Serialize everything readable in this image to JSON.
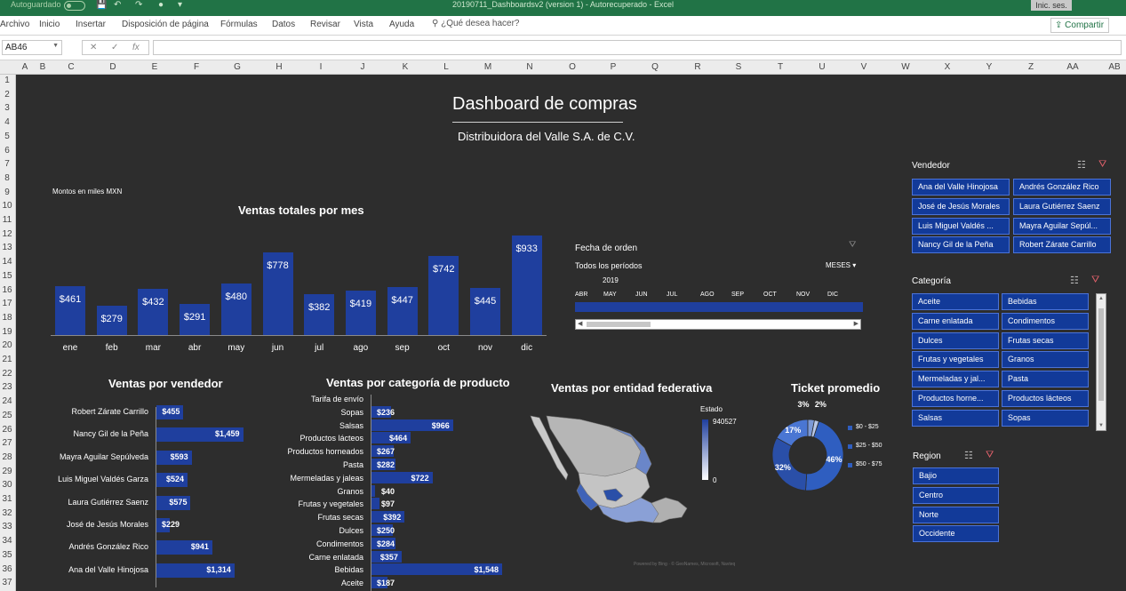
{
  "window": {
    "autosave_label": "Autoguardado",
    "document_title": "20190711_Dashboardsv2 (version 1) - Autorecuperado - Excel",
    "signin_label": "Inic. ses."
  },
  "ribbon": {
    "tabs": [
      "Archivo",
      "Inicio",
      "Insertar",
      "Disposición de página",
      "Fórmulas",
      "Datos",
      "Revisar",
      "Vista",
      "Ayuda"
    ],
    "tell_me": "¿Qué desea hacer?",
    "share_label": "Compartir"
  },
  "formula_bar": {
    "name_box": "AB46",
    "cancel_glyph": "✕",
    "enter_glyph": "✓",
    "fx_glyph": "fx",
    "formula": ""
  },
  "columns": [
    "A",
    "B",
    "C",
    "D",
    "E",
    "F",
    "G",
    "H",
    "I",
    "J",
    "K",
    "L",
    "M",
    "N",
    "O",
    "P",
    "Q",
    "R",
    "S",
    "T",
    "U",
    "V",
    "W",
    "X",
    "Y",
    "Z",
    "AA",
    "AB"
  ],
  "rows": [
    "1",
    "2",
    "3",
    "4",
    "5",
    "6",
    "7",
    "8",
    "9",
    "10",
    "11",
    "12",
    "13",
    "14",
    "15",
    "16",
    "17",
    "18",
    "19",
    "20",
    "21",
    "22",
    "23",
    "24",
    "25",
    "26",
    "27",
    "28",
    "29",
    "30",
    "31",
    "32",
    "33",
    "34",
    "35",
    "36",
    "37"
  ],
  "dashboard": {
    "title": "Dashboard de compras",
    "subtitle": "Distribuidora del Valle S.A. de C.V.",
    "amount_note": "Montos en miles MXN"
  },
  "chart_data": [
    {
      "type": "bar",
      "title": "Ventas totales por mes",
      "categories": [
        "ene",
        "feb",
        "mar",
        "abr",
        "may",
        "jun",
        "jul",
        "ago",
        "sep",
        "oct",
        "nov",
        "dic"
      ],
      "values": [
        461,
        279,
        432,
        291,
        480,
        778,
        382,
        419,
        447,
        742,
        445,
        933
      ],
      "value_labels": [
        "$461",
        "$279",
        "$432",
        "$291",
        "$480",
        "$778",
        "$382",
        "$419",
        "$447",
        "$742",
        "$445",
        "$933"
      ],
      "ylim": [
        0,
        950
      ],
      "grid": false,
      "color": "#1f3f9e"
    },
    {
      "type": "bar",
      "orientation": "horizontal",
      "title": "Ventas por vendedor",
      "categories": [
        "Robert Zárate Carrillo",
        "Nancy Gil de la Peña",
        "Mayra Aguilar Sepúlveda",
        "Luis Miguel Valdés Garza",
        "Laura Gutiérrez Saenz",
        "José de Jesús Morales",
        "Andrés González Rico",
        "Ana del Valle Hinojosa"
      ],
      "values": [
        455,
        1459,
        593,
        524,
        575,
        229,
        941,
        1314
      ],
      "value_labels": [
        "$455",
        "$1,459",
        "$593",
        "$524",
        "$575",
        "$229",
        "$941",
        "$1,314"
      ],
      "xlim": [
        0,
        1600
      ],
      "color": "#1f3f9e"
    },
    {
      "type": "bar",
      "orientation": "horizontal",
      "title": "Ventas por categoría de producto",
      "categories": [
        "Tarifa de envío",
        "Sopas",
        "Salsas",
        "Productos lácteos",
        "Productos horneados",
        "Pasta",
        "Mermeladas y jaleas",
        "Granos",
        "Frutas y vegetales",
        "Frutas secas",
        "Dulces",
        "Condimentos",
        "Carne enlatada",
        "Bebidas",
        "Aceite"
      ],
      "values": [
        0,
        236,
        966,
        464,
        267,
        282,
        722,
        40,
        97,
        392,
        250,
        284,
        357,
        1548,
        187
      ],
      "value_labels": [
        "",
        "$236",
        "$966",
        "$464",
        "$267",
        "$282",
        "$722",
        "$40",
        "$97",
        "$392",
        "$250",
        "$284",
        "$357",
        "$1,548",
        "$187"
      ],
      "xlim": [
        0,
        1600
      ],
      "color": "#1f3f9e"
    },
    {
      "type": "pie",
      "title": "Ticket promedio",
      "donut": true,
      "labels": [
        "$0 - $25",
        "$25 - $50",
        "$50 - $75"
      ],
      "slices": [
        {
          "label": "46%",
          "value": 46,
          "color": "#2f5ec0"
        },
        {
          "label": "32%",
          "value": 32,
          "color": "#2a4fa8"
        },
        {
          "label": "17%",
          "value": 17,
          "color": "#4a76d3"
        },
        {
          "label": "3%",
          "value": 3,
          "color": "#7c99d6"
        },
        {
          "label": "2%",
          "value": 2,
          "color": "#b9c8e8"
        }
      ],
      "legend": "right"
    }
  ],
  "map": {
    "title": "Ventas por entidad federativa",
    "legend_title": "Estado",
    "legend_max": "940527",
    "legend_min": "0",
    "watermark": "Powered by Bing  ·  © GeoNames, Microsoft, Navteq"
  },
  "timeline": {
    "header": "Fecha de orden",
    "periods_label": "Todos los períodos",
    "level": "MESES",
    "year": "2019",
    "months": [
      "ABR",
      "MAY",
      "JUN",
      "JUL",
      "AGO",
      "SEP",
      "OCT",
      "NOV",
      "DIC"
    ]
  },
  "slicers": {
    "vendedor": {
      "title": "Vendedor",
      "items": [
        "Ana del Valle Hinojosa",
        "Andrés González Rico",
        "José de Jesús Morales",
        "Laura Gutiérrez Saenz",
        "Luis Miguel Valdés ...",
        "Mayra Aguilar Sepúl...",
        "Nancy Gil de la Peña",
        "Robert Zárate Carrillo"
      ]
    },
    "categoria": {
      "title": "Categoría",
      "items": [
        "Aceite",
        "Bebidas",
        "Carne enlatada",
        "Condimentos",
        "Dulces",
        "Frutas secas",
        "Frutas y vegetales",
        "Granos",
        "Mermeladas y jal...",
        "Pasta",
        "Productos horne...",
        "Productos lácteos",
        "Salsas",
        "Sopas"
      ]
    },
    "region": {
      "title": "Region",
      "items": [
        "Bajio",
        "Centro",
        "Norte",
        "Occidente"
      ]
    }
  },
  "colors": {
    "excel_green": "#217346",
    "dashboard_bg": "#2d2d2d",
    "bar_blue": "#1f3f9e",
    "slicer_bg": "#123a99",
    "slicer_border": "#4b73d8"
  }
}
